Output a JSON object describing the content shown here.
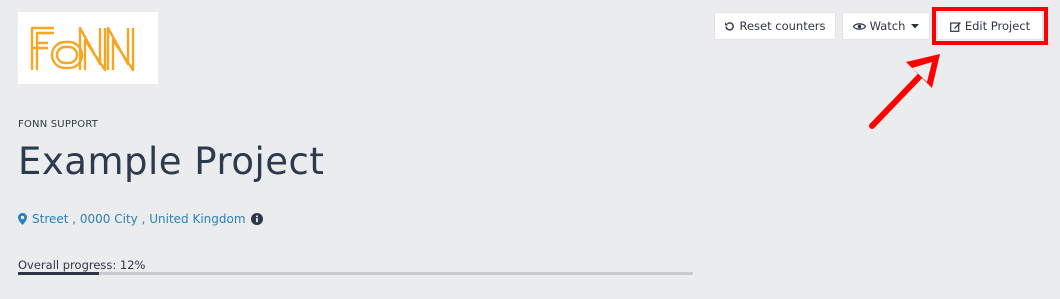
{
  "header": {
    "logo_text": "FONN",
    "org_name": "FONN SUPPORT",
    "project_title": "Example Project"
  },
  "location": {
    "address": "Street , 0000 City , United Kingdom",
    "pin_icon": "map-marker-icon",
    "info_icon": "info-circle-icon"
  },
  "progress": {
    "label": "Overall progress: 12%",
    "fraction": 0.12
  },
  "toolbar": {
    "reset_label": "Reset counters",
    "reset_icon": "undo-icon",
    "watch_label": "Watch",
    "watch_icon": "eye-icon",
    "edit_label": "Edit Project",
    "edit_icon": "edit-icon"
  },
  "annotation": {
    "highlight_color": "#ff0000"
  },
  "colors": {
    "background": "#ebecee",
    "link": "#2a7fbd",
    "logo": "#f5a623"
  }
}
